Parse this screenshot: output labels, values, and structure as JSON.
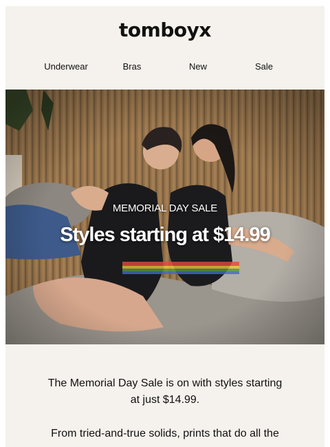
{
  "brand": {
    "logo_text": "tomboyx"
  },
  "nav": {
    "items": [
      "Underwear",
      "Bras",
      "New",
      "Sale"
    ]
  },
  "hero": {
    "eyebrow": "MEMORIAL DAY SALE",
    "headline": "Styles starting at $14.99",
    "image": "photo-two-models-in-black-underwear-on-couch"
  },
  "body": {
    "paragraph_1": "The Memorial Day Sale is on with styles starting at just $14.99.",
    "paragraph_2": "From tried-and-true solids, prints that do all the"
  }
}
